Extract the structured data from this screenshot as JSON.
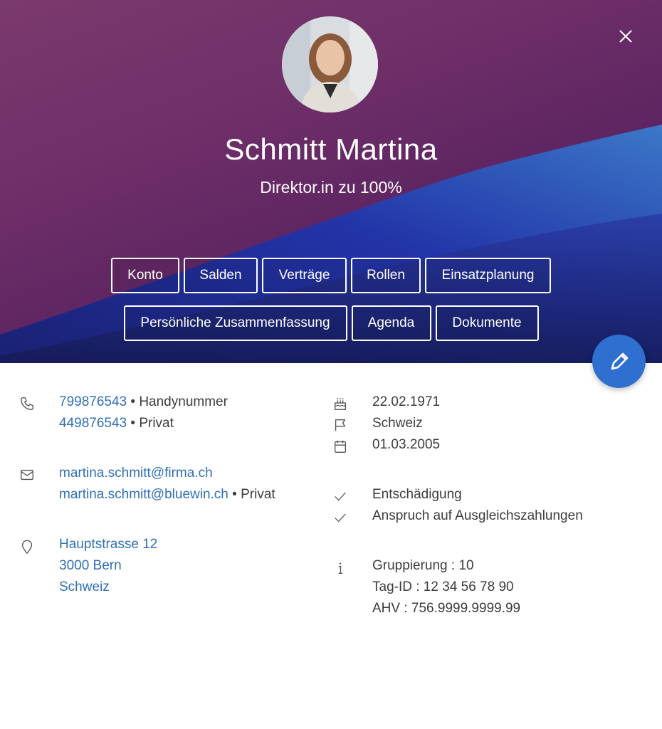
{
  "profile": {
    "name": "Schmitt Martina",
    "role": "Direktor.in zu 100%"
  },
  "tabs_row1": [
    "Konto",
    "Salden",
    "Verträge",
    "Rollen",
    "Einsatzplanung"
  ],
  "tabs_row2": [
    "Persönliche Zusammenfassung",
    "Agenda",
    "Dokumente"
  ],
  "phones": [
    {
      "number": "799876543",
      "label": "Handynummer"
    },
    {
      "number": "449876543",
      "label": "Privat"
    }
  ],
  "emails": [
    {
      "address": "martina.schmitt@firma.ch",
      "label": ""
    },
    {
      "address": "martina.schmitt@bluewin.ch",
      "label": "Privat"
    }
  ],
  "address": {
    "street": "Hauptstrasse 12",
    "city": "3000 Bern",
    "country": "Schweiz"
  },
  "personal": {
    "birthdate": "22.02.1971",
    "nationality": "Schweiz",
    "entry_date": "01.03.2005"
  },
  "flags": [
    "Entschädigung",
    "Anspruch auf Ausgleichszahlungen"
  ],
  "info": [
    "Gruppierung : 10",
    "Tag-ID : 12 34 56 78 90",
    "AHV : 756.9999.9999.99"
  ],
  "separator": "•",
  "colors": {
    "accent": "#2f6fd0",
    "link": "#2f6fb8",
    "hero": "#6e2e68",
    "wave": "#1f2f9a"
  },
  "icons": {
    "close": "close-icon",
    "edit": "pencil-icon",
    "phone": "phone-icon",
    "email": "envelope-icon",
    "address": "map-pin-icon",
    "birthday": "cake-icon",
    "nationality": "flag-icon",
    "entry": "calendar-icon",
    "check": "check-icon",
    "info": "info-icon"
  }
}
